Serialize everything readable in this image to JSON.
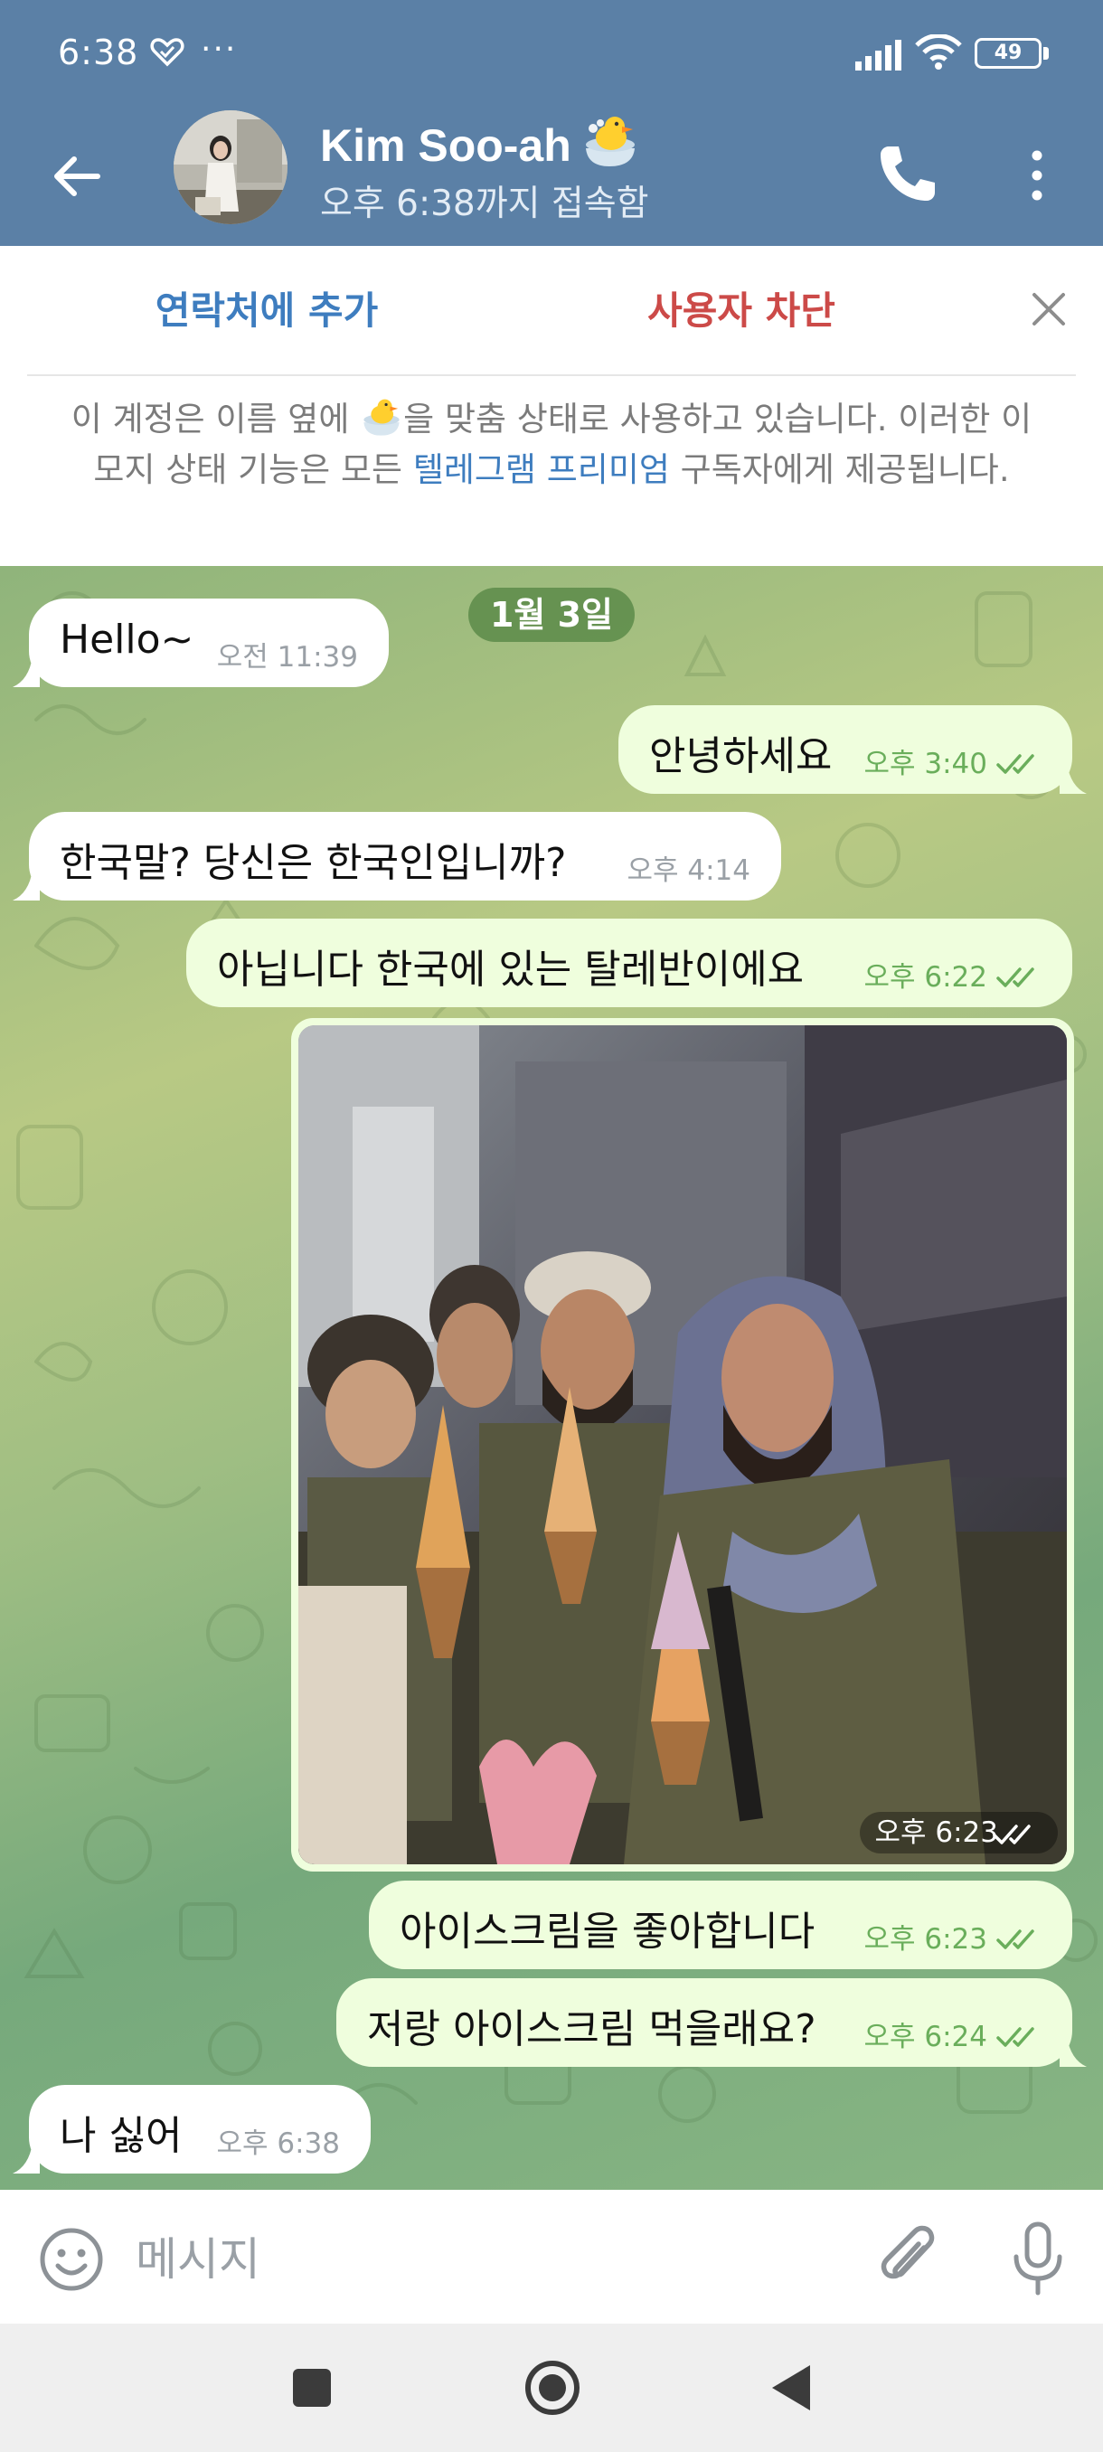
{
  "status_bar": {
    "time": "6:38",
    "dots": "···",
    "battery": "49"
  },
  "header": {
    "name": "Kim Soo-ah",
    "status": "오후 6:38까지 접속함"
  },
  "action_bar": {
    "add_contact": "연락처에 추가",
    "block_user": "사용자 차단",
    "notice_before": "이 계정은 이름 옆에 ",
    "notice_mid": "을 맞춤 상태로 사용하고 있습니다. 이러한 이모지 상태 기능은 모든 ",
    "notice_link": "텔레그램 프리미엄",
    "notice_after": " 구독자에게 제공됩니다."
  },
  "chat": {
    "date_label": "1월 3일",
    "messages": [
      {
        "direction": "in",
        "text": "Hello~",
        "time": "오전 11:39"
      },
      {
        "direction": "out",
        "text": "안녕하세요",
        "time": "오후 3:40"
      },
      {
        "direction": "in",
        "text": "한국말? 당신은 한국인입니까?",
        "time": "오후 4:14"
      },
      {
        "direction": "out",
        "text": "아닙니다 한국에 있는 탈레반이에요",
        "time": "오후 6:22"
      },
      {
        "direction": "out",
        "type": "photo",
        "time": "오후 6:23"
      },
      {
        "direction": "out",
        "text": "아이스크림을 좋아합니다",
        "time": "오후 6:23"
      },
      {
        "direction": "out",
        "text": "저랑 아이스크림 먹을래요?",
        "time": "오후 6:24"
      },
      {
        "direction": "in",
        "text": "나 싫어",
        "time": "오후 6:38"
      }
    ]
  },
  "input_bar": {
    "placeholder": "메시지"
  },
  "colors": {
    "header": "#5b80a6",
    "link": "#3e7dbf",
    "danger": "#cc4a48",
    "bubble_out": "#effedd",
    "bubble_in": "#ffffff",
    "tick": "#6aae5b"
  },
  "icons": [
    "back-arrow-icon",
    "phone-icon",
    "more-vert-icon",
    "close-icon",
    "smile-icon",
    "paperclip-icon",
    "mic-icon",
    "double-check-icon",
    "duck-emoji-icon",
    "heart-icon",
    "signal-icon",
    "wifi-icon"
  ]
}
